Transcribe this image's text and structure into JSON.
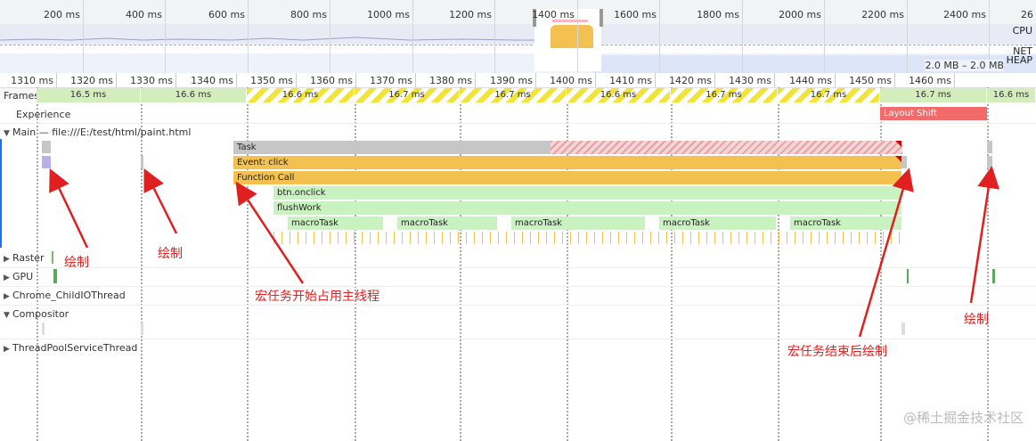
{
  "overview": {
    "ticks": [
      "200 ms",
      "400 ms",
      "600 ms",
      "800 ms",
      "1000 ms",
      "1200 ms",
      "1400 ms",
      "1600 ms",
      "1800 ms",
      "2000 ms",
      "2200 ms",
      "2400 ms",
      "26"
    ],
    "cpu_label": "CPU",
    "net_label": "NET",
    "heap_label": "HEAP",
    "heap_range": "2.0 MB – 2.0 MB"
  },
  "ruler": {
    "ticks": [
      "1310 ms",
      "1320 ms",
      "1330 ms",
      "1340 ms",
      "1350 ms",
      "1360 ms",
      "1370 ms",
      "1380 ms",
      "1390 ms",
      "1400 ms",
      "1410 ms",
      "1420 ms",
      "1430 ms",
      "1440 ms",
      "1450 ms",
      "1460 ms"
    ]
  },
  "tracks": {
    "frames": "Frames",
    "experience": "Experience",
    "main": "Main — file:///E:/test/html/paint.html",
    "raster": "Raster",
    "gpu": "GPU",
    "chrome_child": "Chrome_ChildIOThread",
    "compositor": "Compositor",
    "threadpool": "ThreadPoolServiceThread"
  },
  "frames": [
    "16.5 ms",
    "16.6 ms",
    "16.6 ms",
    "16.7 ms",
    "16.7 ms",
    "16.6 ms",
    "16.7 ms",
    "16.7 ms",
    "16.7 ms",
    "16.6 ms"
  ],
  "experience": {
    "layout_shift": "Layout Shift"
  },
  "flame": {
    "task": "Task",
    "event": "Event: click",
    "function_call": "Function Call",
    "btn": "btn.onclick",
    "flush": "flushWork",
    "macros": [
      "macroTask",
      "macroTask",
      "macroTask",
      "macroTask",
      "macroTask"
    ]
  },
  "annotations": {
    "paint1": "绘制",
    "paint2": "绘制",
    "macro_start": "宏任务开始占用主线程",
    "macro_end": "宏任务结束后绘制",
    "paint3": "绘制"
  },
  "watermark": "@稀土掘金技术社区",
  "colors": {
    "frame_ok": "#d4edbc",
    "frame_warn": "#f1e338",
    "task": "#c6c6c6",
    "event": "#f2c150",
    "script_green": "#c8f2bf",
    "layout_shift": "#f26b6b",
    "annotation": "#e02020",
    "selection_accent": "#1a73e8"
  }
}
